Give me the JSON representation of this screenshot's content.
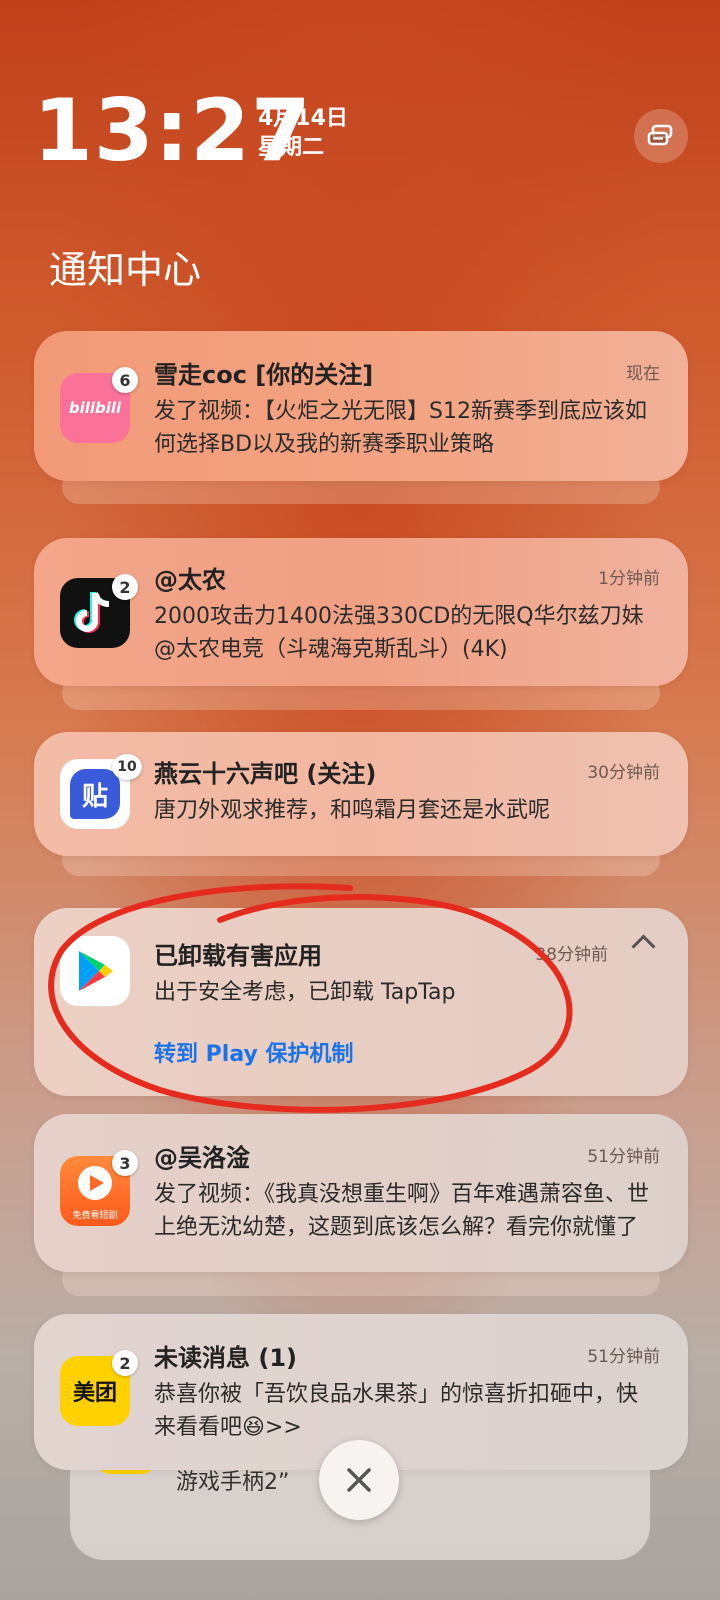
{
  "status": {
    "time": "13:27",
    "date": "4月14日",
    "weekday": "星期二"
  },
  "header": {
    "title": "通知中心",
    "manage_icon": "notification-manage-icon"
  },
  "notifications": [
    {
      "app": "bilibili",
      "icon_text": "bilibili",
      "badge": "6",
      "title": "雪走coc [你的关注]",
      "time": "现在",
      "body": "发了视频：【火炬之光无限】S12新赛季到底应该如何选择BD以及我的新赛季职业策略"
    },
    {
      "app": "douyin",
      "badge": "2",
      "title": "@太农",
      "time": "1分钟前",
      "body": "2000攻击力1400法强330CD的无限Q华尔兹刀妹 @太农电竞（斗魂海克斯乱斗）(4K)"
    },
    {
      "app": "tieba",
      "icon_text": "贴",
      "badge": "10",
      "title": "燕云十六声吧 (关注)",
      "time": "30分钟前",
      "body": "唐刀外观求推荐，和鸣霜月套还是水武呢"
    },
    {
      "app": "google-play",
      "title": "已卸载有害应用",
      "time": "38分钟前",
      "body": "出于安全考虑，已卸载 TapTap",
      "action": "转到 Play 保护机制"
    },
    {
      "app": "free-short-drama",
      "icon_text": "免费看短剧",
      "badge": "3",
      "title": "@吴洛淦",
      "time": "51分钟前",
      "body": "发了视频：《我真没想重生啊》百年难遇萧容鱼、世上绝无沈幼楚，这题到底该怎么解？看完你就懂了"
    },
    {
      "app": "meituan",
      "icon_text": "美团",
      "badge": "2",
      "title": "未读消息 (1)",
      "time": "51分钟前",
      "body": "恭喜你被「吾饮良品水果茶」的惊喜折扣砸中，快来看看吧😆>>"
    }
  ],
  "peek": {
    "body": "游戏手柄2”"
  },
  "close": {
    "icon": "close-icon"
  },
  "colors": {
    "accent": "#1a73e8",
    "annotation": "#e52b1e"
  }
}
